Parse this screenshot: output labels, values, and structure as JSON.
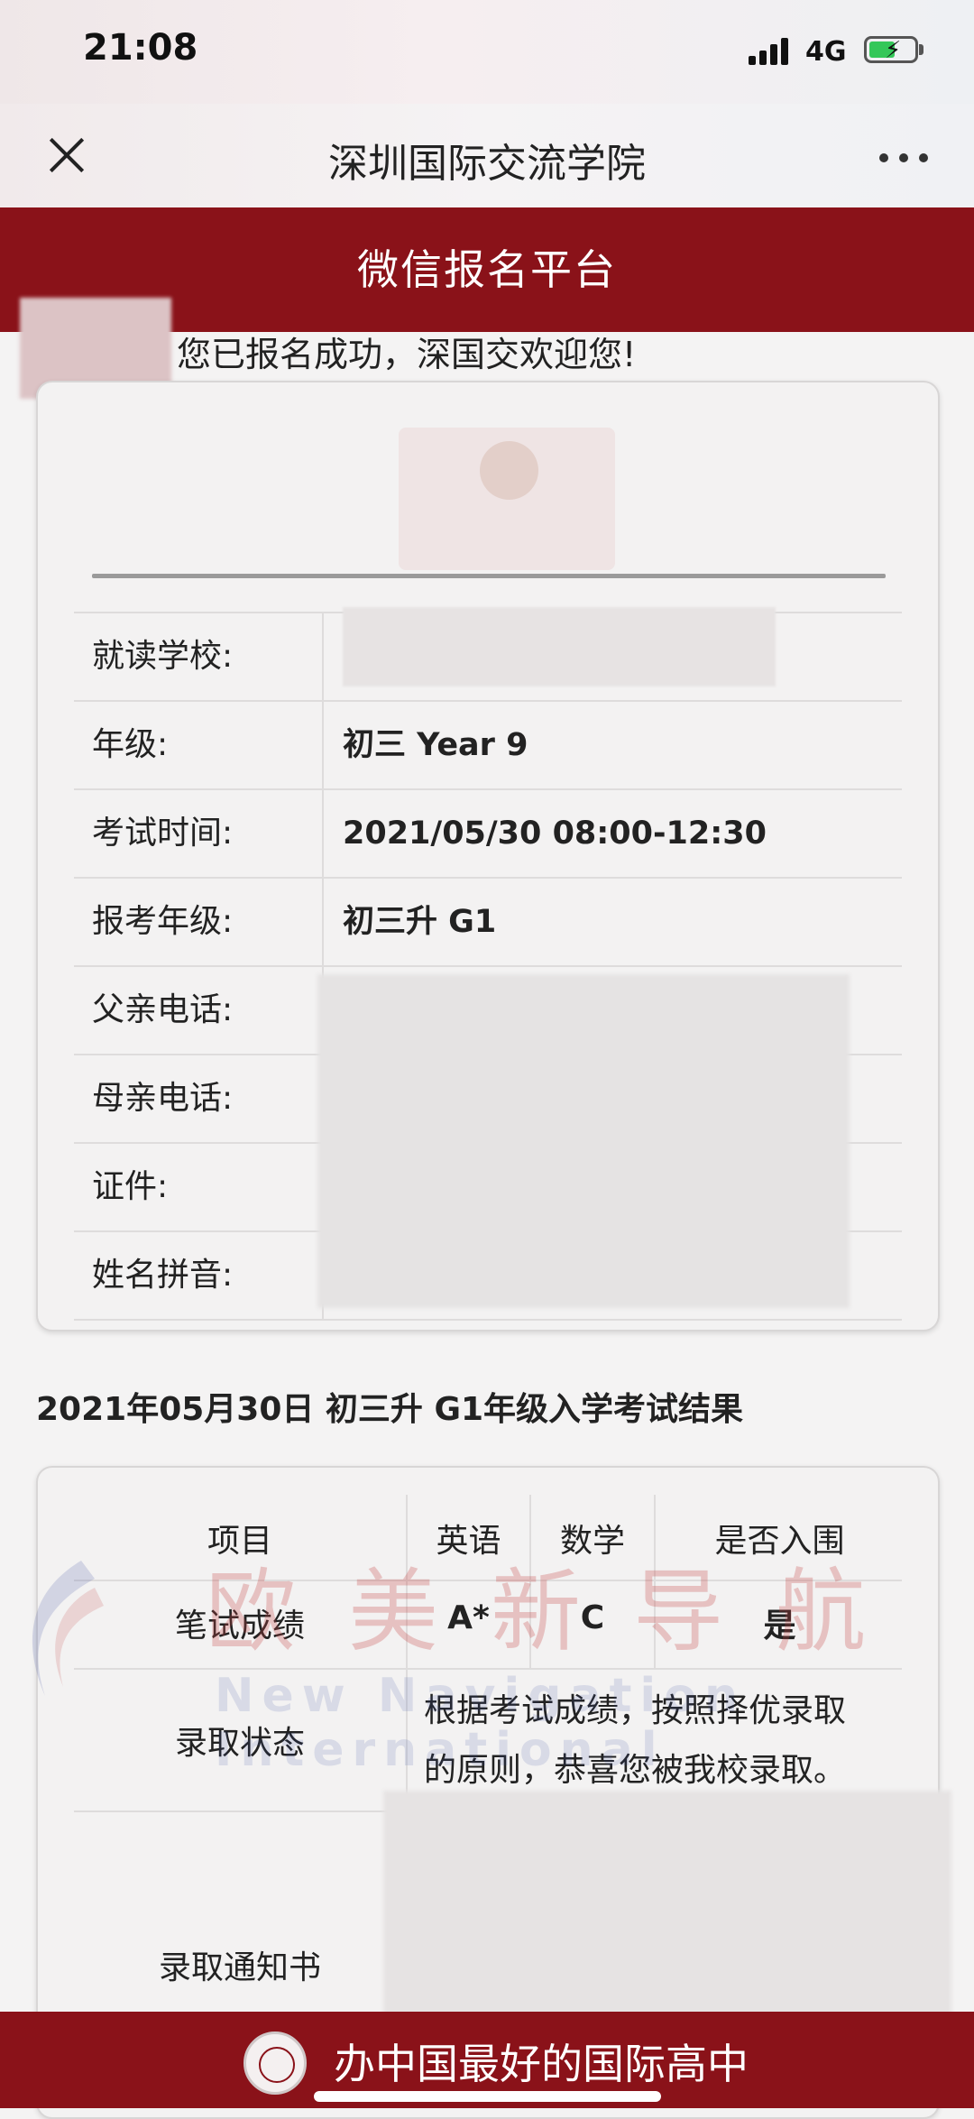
{
  "status_bar": {
    "time": "21:08",
    "network": "4G",
    "battery_level": 0.55,
    "charging": true
  },
  "nav": {
    "title": "深圳国际交流学院",
    "close_icon": "close-icon",
    "more_icon": "more-icon"
  },
  "header": {
    "title": "微信报名平台"
  },
  "welcome": {
    "text": "您已报名成功，深国交欢迎您!"
  },
  "info": {
    "rows": [
      {
        "label": "就读学校:",
        "value": ""
      },
      {
        "label": "年级:",
        "value": "初三 Year 9"
      },
      {
        "label": "考试时间:",
        "value": "2021/05/30 08:00-12:30"
      },
      {
        "label": "报考年级:",
        "value": "初三升 G1"
      },
      {
        "label": "父亲电话:",
        "value": ""
      },
      {
        "label": "母亲电话:",
        "value": ""
      },
      {
        "label": "证件:",
        "value": ""
      },
      {
        "label": "姓名拼音:",
        "value": ""
      }
    ]
  },
  "result": {
    "heading": "2021年05月30日 初三升 G1年级入学考试结果",
    "headers": {
      "item": "项目",
      "english": "英语",
      "math": "数学",
      "shortlisted": "是否入围"
    },
    "written": {
      "label": "笔试成绩",
      "english": "A*",
      "math": "C",
      "shortlisted": "是"
    },
    "admission": {
      "label": "录取状态",
      "text_line1": "根据考试成绩，按照择优录取",
      "text_line2": "的原则，恭喜您被我校录取。"
    },
    "notice": {
      "label": "录取通知书"
    }
  },
  "watermark": {
    "cn": "欧美新导航",
    "en": "New Navigation International"
  },
  "footer": {
    "text": "办中国最好的国际高中"
  }
}
